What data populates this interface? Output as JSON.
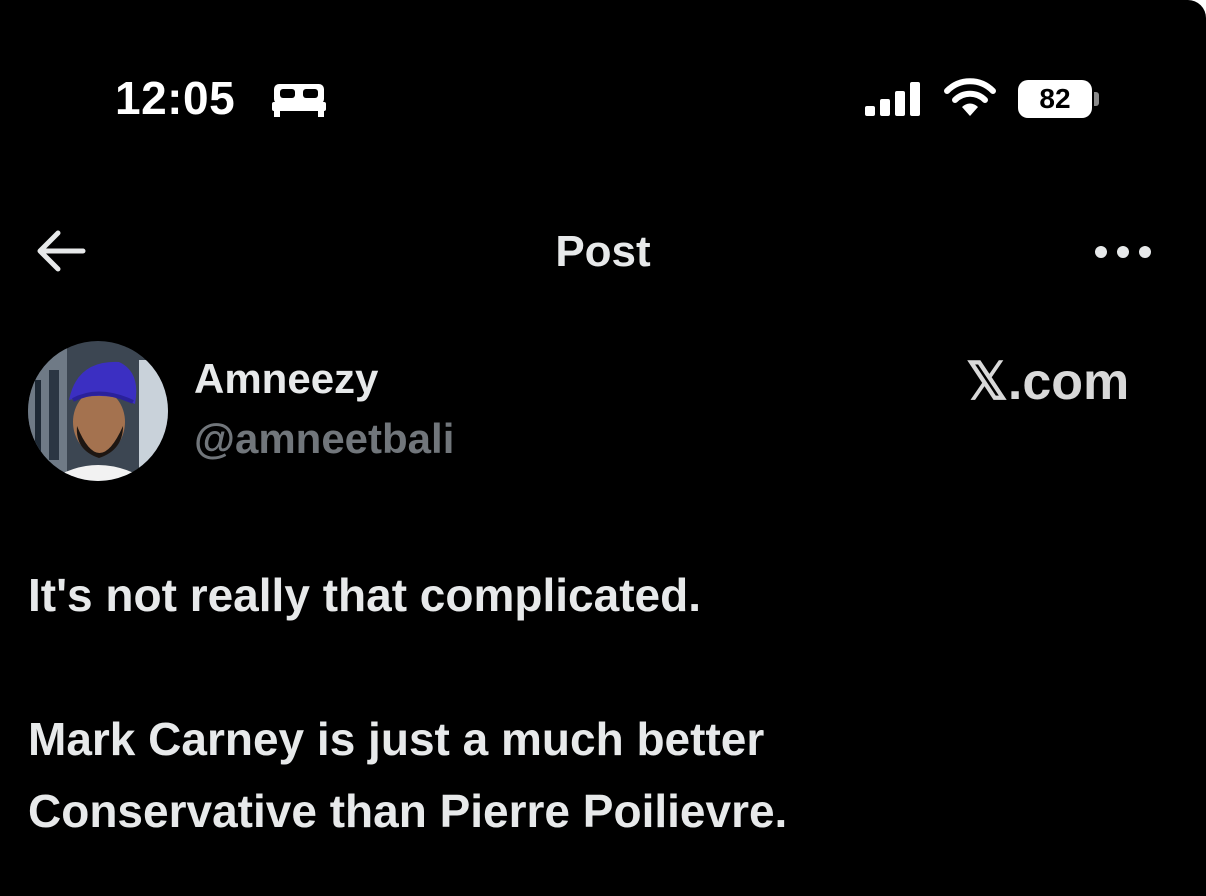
{
  "status_bar": {
    "time": "12:05",
    "sleep_icon": "bed-icon",
    "signal_icon": "cellular-signal-icon",
    "wifi_icon": "wifi-icon",
    "battery_level": "82"
  },
  "header": {
    "title": "Post",
    "back_icon": "arrow-left-icon",
    "more_icon": "ellipsis-icon"
  },
  "post": {
    "author": {
      "display_name": "Amneezy",
      "handle": "@amneetbali",
      "avatar": "profile-photo"
    },
    "watermark": "𝕏.com",
    "text_lines": [
      "It's not really that complicated.",
      "Mark Carney is just a much better",
      "Conservative than Pierre Poilievre."
    ]
  },
  "colors": {
    "background": "#000000",
    "primary_text": "#e7e9ea",
    "secondary_text": "#71767b"
  }
}
